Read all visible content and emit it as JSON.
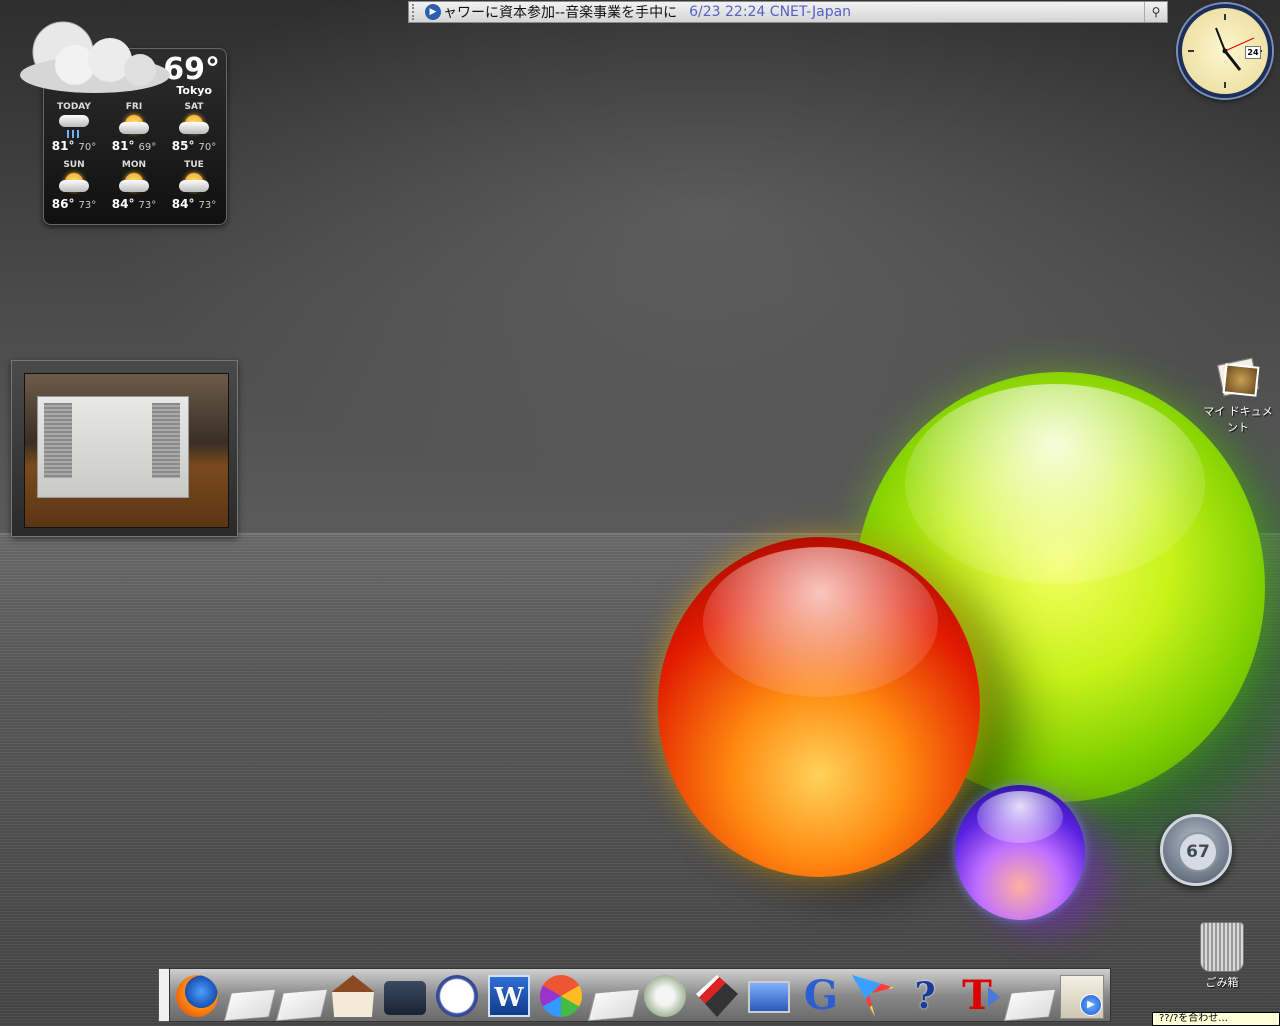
{
  "ticker": {
    "headline": "ャワーに資本参加--音楽事業を手中に",
    "meta": "6/23 22:24 CNET-Japan"
  },
  "weather": {
    "current_temp": "69°",
    "city": "Tokyo",
    "days": [
      {
        "name": "TODAY",
        "hi": "81°",
        "lo": "70°",
        "icon": "rain-cloud-icon"
      },
      {
        "name": "FRI",
        "hi": "81°",
        "lo": "69°",
        "icon": "sun-cloud-icon"
      },
      {
        "name": "SAT",
        "hi": "85°",
        "lo": "70°",
        "icon": "sun-cloud-icon"
      },
      {
        "name": "SUN",
        "hi": "86°",
        "lo": "73°",
        "icon": "sun-cloud-icon"
      },
      {
        "name": "MON",
        "hi": "84°",
        "lo": "73°",
        "icon": "sun-cloud-icon"
      },
      {
        "name": "TUE",
        "hi": "84°",
        "lo": "73°",
        "icon": "sun-cloud-icon"
      }
    ]
  },
  "clock": {
    "date": "24"
  },
  "desktop": {
    "my_documents": "マイ ドキュメント",
    "trash": "ごみ箱",
    "counter": "67"
  },
  "dock": {
    "items": [
      "firefox-icon",
      "folder-icon",
      "folder-icon",
      "house-icon",
      "briefcase-icon",
      "clock-icon",
      "word-icon",
      "picasa-icon",
      "folder-icon",
      "itunes-icon",
      "tools-icon",
      "monitors-icon",
      "google-icon",
      "arrow-icon",
      "help-icon",
      "type-icon",
      "folder-icon",
      "documents-icon"
    ],
    "word_letter": "W",
    "google_letter": "G",
    "help_letter": "?",
    "type_letter": "T"
  },
  "tooltip": {
    "text": "??/?を合わせ..."
  }
}
